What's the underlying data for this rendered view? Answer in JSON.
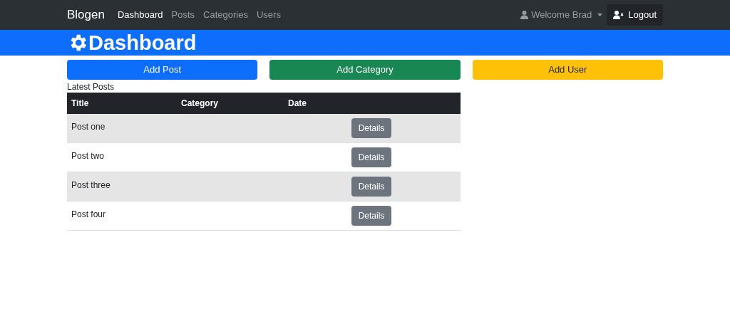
{
  "navbar": {
    "brand": "Blogen",
    "links": [
      {
        "label": "Dashboard",
        "selected": true
      },
      {
        "label": "Posts",
        "selected": false
      },
      {
        "label": "Categories",
        "selected": false
      },
      {
        "label": "Users",
        "selected": false
      }
    ],
    "user_menu": "Welcome Brad",
    "logout": "Logout"
  },
  "header": {
    "title": "Dashboard"
  },
  "actions": [
    {
      "label": "Add Post",
      "kind": "primary"
    },
    {
      "label": "Add Category",
      "kind": "success"
    },
    {
      "label": "Add User",
      "kind": "warning"
    }
  ],
  "table": {
    "caption": "Latest Posts",
    "columns": [
      "Title",
      "Category",
      "Date"
    ],
    "rows": [
      {
        "title": "Post one",
        "button": "Details"
      },
      {
        "title": "Post two",
        "button": "Details"
      },
      {
        "title": "Post three",
        "button": "Details"
      },
      {
        "title": "Post four",
        "button": "Details"
      }
    ]
  }
}
